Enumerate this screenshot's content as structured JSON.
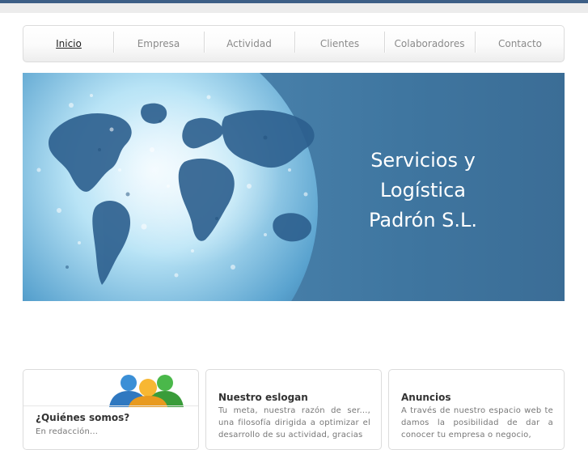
{
  "nav": {
    "items": [
      {
        "label": "Inicio",
        "active": true
      },
      {
        "label": "Empresa",
        "active": false
      },
      {
        "label": "Actividad",
        "active": false
      },
      {
        "label": "Clientes",
        "active": false
      },
      {
        "label": "Colaboradores",
        "active": false
      },
      {
        "label": "Contacto",
        "active": false
      }
    ]
  },
  "hero": {
    "title_line1": "Servicios y",
    "title_line2": "Logística",
    "title_line3": "Padrón S.L."
  },
  "cards": {
    "about": {
      "title": "¿Quiénes somos?",
      "text": "En redacción..."
    },
    "slogan": {
      "title": "Nuestro eslogan",
      "text": "Tu meta, nuestra razón de ser..., una filosofía dirigida a optimizar el desarrollo de su actividad, gracias"
    },
    "announcements": {
      "title": "Anuncios",
      "text": "A través de nuestro espacio web te damos la posibilidad de dar a conocer tu empresa o negocio,"
    }
  },
  "colors": {
    "topbar": "#3d5f86",
    "hero_dark": "#3b6d96",
    "hero_light": "#9ed0e6"
  },
  "icons": {
    "hero": "world-globe-icon",
    "about": "users-group-icon"
  }
}
